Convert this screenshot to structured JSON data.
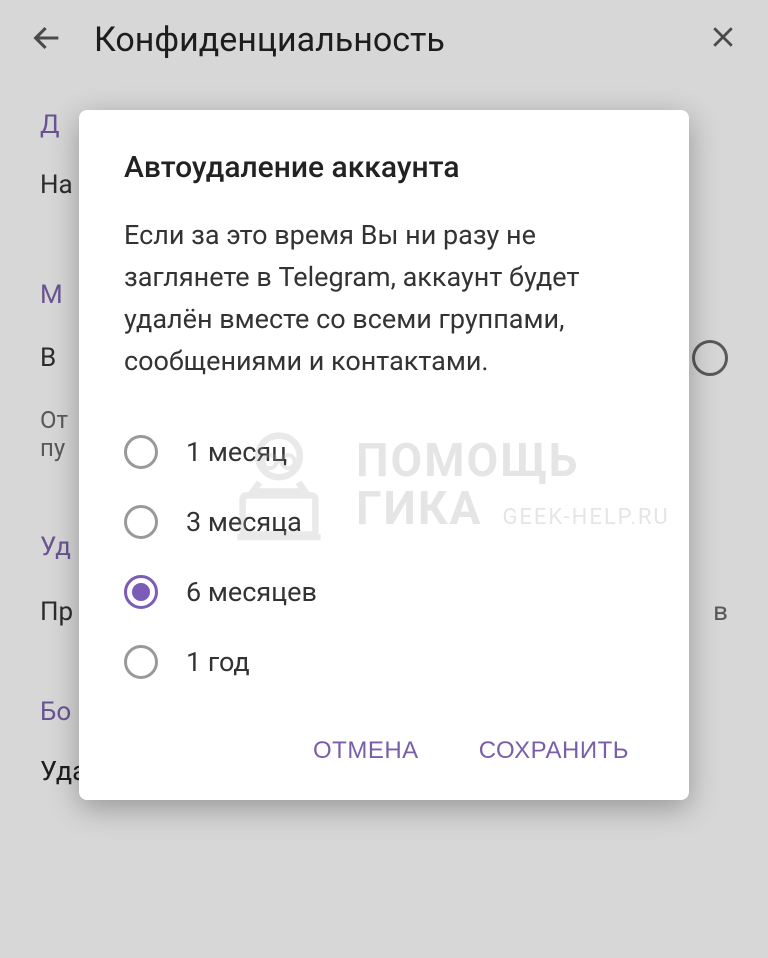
{
  "header": {
    "title": "Конфиденциальность"
  },
  "background": {
    "item1": "Д",
    "item2": "На",
    "item3": "М",
    "item4": "В",
    "item5_line1": "От",
    "item5_line2": "пу",
    "item6": "Уд",
    "item7": "Пр",
    "item7_right": "в",
    "item8": "Бо",
    "delete_text": "Удалить данные о платежах и доставке"
  },
  "dialog": {
    "title": "Автоудаление аккаунта",
    "description": "Если за это время Вы ни разу не заглянете в Telegram, аккаунт будет удалён вместе со всеми группами, сообщениями и контактами.",
    "options": [
      {
        "label": "1 месяц",
        "selected": false
      },
      {
        "label": "3 месяца",
        "selected": false
      },
      {
        "label": "6 месяцев",
        "selected": true
      },
      {
        "label": "1 год",
        "selected": false
      }
    ],
    "cancel_label": "ОТМЕНА",
    "save_label": "СОХРАНИТЬ"
  },
  "watermark": {
    "line1": "ПОМОЩЬ",
    "line2": "ГИКА",
    "sub": "GEEK-HELP.RU"
  }
}
